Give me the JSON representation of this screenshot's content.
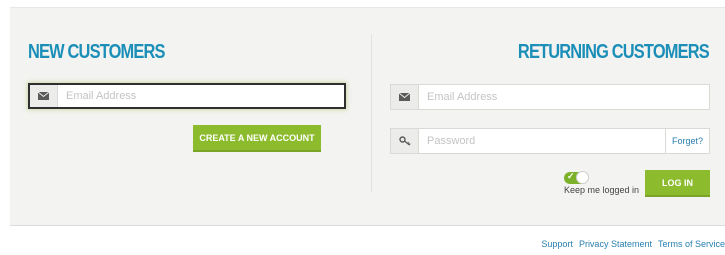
{
  "new_customers": {
    "heading": "NEW CUSTOMERS",
    "email_placeholder": "Email Address",
    "create_account_label": "CREATE A NEW ACCOUNT"
  },
  "returning_customers": {
    "heading": "RETURNING CUSTOMERS",
    "email_placeholder": "Email Address",
    "password_placeholder": "Password",
    "forgot_label": "Forget?",
    "keep_logged_in_label": "Keep me logged in",
    "keep_logged_in_checked": true,
    "login_label": "LOG IN"
  },
  "footer": {
    "links": [
      "Support",
      "Privacy Statement",
      "Terms of Service"
    ]
  },
  "icons": {
    "email": "envelope-icon",
    "password": "key-icon",
    "toggle_check": "check-icon"
  },
  "colors": {
    "heading_blue": "#1b8fb8",
    "button_green": "#8cbc2e",
    "link_blue": "#2a7fb0",
    "panel_bg": "#f3f3f1"
  }
}
